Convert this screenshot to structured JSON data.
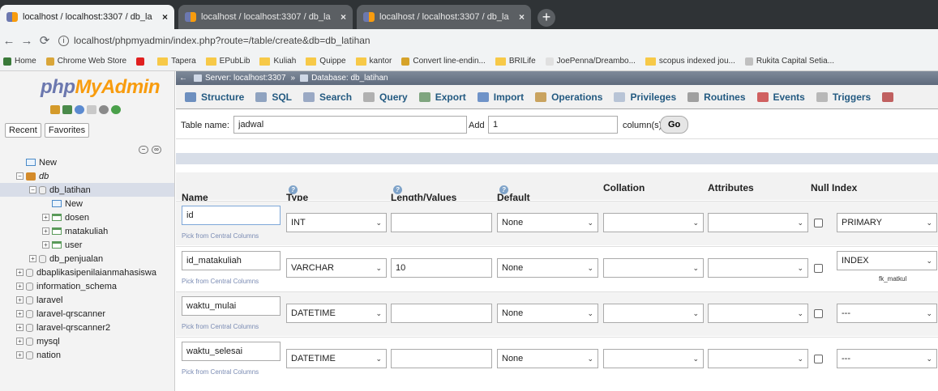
{
  "browser": {
    "tabs": [
      {
        "title": "localhost / localhost:3307 / db_la",
        "active": true
      },
      {
        "title": "localhost / localhost:3307 / db_la",
        "active": false
      },
      {
        "title": "localhost / localhost:3307 / db_la",
        "active": false
      }
    ],
    "new_tab_label": "+",
    "url": "localhost/phpmyadmin/index.php?route=/table/create&db=db_latihan",
    "bookmarks": [
      {
        "label": "Home",
        "icon": "home-icon"
      },
      {
        "label": "Chrome Web Store",
        "icon": "store-icon"
      },
      {
        "label": "",
        "icon": "youtube-icon"
      },
      {
        "label": "Tapera",
        "icon": "folder-icon"
      },
      {
        "label": "EPubLib",
        "icon": "folder-icon"
      },
      {
        "label": "Kuliah",
        "icon": "folder-icon"
      },
      {
        "label": "Quippe",
        "icon": "folder-icon"
      },
      {
        "label": "kantor",
        "icon": "folder-icon"
      },
      {
        "label": "Convert line-endin...",
        "icon": "convert-icon"
      },
      {
        "label": "BRILife",
        "icon": "folder-icon"
      },
      {
        "label": "JoePenna/Dreambo...",
        "icon": "github-icon"
      },
      {
        "label": "scopus indexed jou...",
        "icon": "folder-icon"
      },
      {
        "label": "Rukita Capital Setia...",
        "icon": "rukita-icon"
      }
    ]
  },
  "sidebar": {
    "logo_php": "php",
    "logo_myadmin": "MyAdmin",
    "tabs": [
      "Recent",
      "Favorites"
    ],
    "tree": [
      {
        "label": "New",
        "level": 0,
        "kind": "new"
      },
      {
        "label": "db",
        "level": 0,
        "kind": "root"
      },
      {
        "label": "db_latihan",
        "level": 1,
        "kind": "db",
        "selected": true
      },
      {
        "label": "New",
        "level": 2,
        "kind": "new"
      },
      {
        "label": "dosen",
        "level": 2,
        "kind": "table"
      },
      {
        "label": "matakuliah",
        "level": 2,
        "kind": "table"
      },
      {
        "label": "user",
        "level": 2,
        "kind": "table"
      },
      {
        "label": "db_penjualan",
        "level": 1,
        "kind": "db"
      },
      {
        "label": "dbaplikasipenilaianmahasiswa",
        "level": 0,
        "kind": "db"
      },
      {
        "label": "information_schema",
        "level": 0,
        "kind": "db"
      },
      {
        "label": "laravel",
        "level": 0,
        "kind": "db"
      },
      {
        "label": "laravel-qrscanner",
        "level": 0,
        "kind": "db"
      },
      {
        "label": "laravel-qrscanner2",
        "level": 0,
        "kind": "db"
      },
      {
        "label": "mysql",
        "level": 0,
        "kind": "db"
      },
      {
        "label": "nation",
        "level": 0,
        "kind": "db"
      }
    ]
  },
  "breadcrumb": {
    "server": "Server: localhost:3307",
    "sep": "»",
    "database": "Database: db_latihan"
  },
  "menu_tabs": [
    {
      "label": "Structure",
      "icon": "structure-icon",
      "color": "#6d8fbf"
    },
    {
      "label": "SQL",
      "icon": "sql-icon",
      "color": "#8fa3c0"
    },
    {
      "label": "Search",
      "icon": "search-icon",
      "color": "#9aa9c4"
    },
    {
      "label": "Query",
      "icon": "query-icon",
      "color": "#b0b0b0"
    },
    {
      "label": "Export",
      "icon": "export-icon",
      "color": "#7fa57f"
    },
    {
      "label": "Import",
      "icon": "import-icon",
      "color": "#6f93c8"
    },
    {
      "label": "Operations",
      "icon": "operations-icon",
      "color": "#c9a35f"
    },
    {
      "label": "Privileges",
      "icon": "privileges-icon",
      "color": "#b8c4d6"
    },
    {
      "label": "Routines",
      "icon": "routines-icon",
      "color": "#a0a0a0"
    },
    {
      "label": "Events",
      "icon": "events-icon",
      "color": "#d06060"
    },
    {
      "label": "Triggers",
      "icon": "triggers-icon",
      "color": "#b8b8b8"
    },
    {
      "label": "",
      "icon": "more-icon",
      "color": "#c06060"
    }
  ],
  "table_form": {
    "table_name_label": "Table name:",
    "table_name_value": "jadwal",
    "add_label": "Add",
    "add_value": "1",
    "columns_label": "column(s)",
    "go_label": "Go"
  },
  "columns_header": {
    "name": "Name",
    "type": "Type",
    "length": "Length/Values",
    "default": "Default",
    "collation": "Collation",
    "attributes": "Attributes",
    "null_index": "Null Index",
    "help_glyph": "?"
  },
  "pick_label": "Pick from Central Columns",
  "rows": [
    {
      "name": "id",
      "type": "INT",
      "length": "",
      "default": "None",
      "collation": "",
      "attributes": "",
      "index": "PRIMARY",
      "fk": ""
    },
    {
      "name": "id_matakuliah",
      "type": "VARCHAR",
      "length": "10",
      "default": "None",
      "collation": "",
      "attributes": "",
      "index": "INDEX",
      "fk": "fk_matkul"
    },
    {
      "name": "waktu_mulai",
      "type": "DATETIME",
      "length": "",
      "default": "None",
      "collation": "",
      "attributes": "",
      "index": "---",
      "fk": ""
    },
    {
      "name": "waktu_selesai",
      "type": "DATETIME",
      "length": "",
      "default": "None",
      "collation": "",
      "attributes": "",
      "index": "---",
      "fk": ""
    }
  ],
  "colors": {
    "chrome_dark": "#2f3336",
    "pma_link": "#235a81",
    "php_logo": "#6c78af",
    "myadmin_logo": "#f89c0e"
  }
}
